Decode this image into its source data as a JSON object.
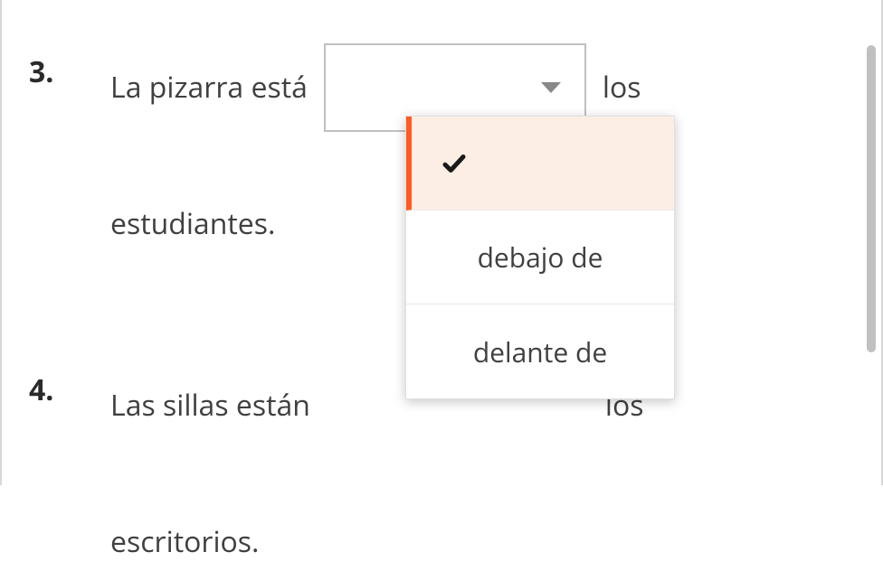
{
  "questions": [
    {
      "number": "3.",
      "text_before": "La pizarra está",
      "text_after": "los",
      "line2": "estudiantes."
    },
    {
      "number": "4.",
      "text_before": "Las sillas están",
      "text_after": "los",
      "line2": "escritorios."
    }
  ],
  "dropdown": {
    "options": [
      {
        "label": "",
        "selected": true
      },
      {
        "label": "debajo de",
        "selected": false
      },
      {
        "label": "delante de",
        "selected": false
      }
    ]
  }
}
